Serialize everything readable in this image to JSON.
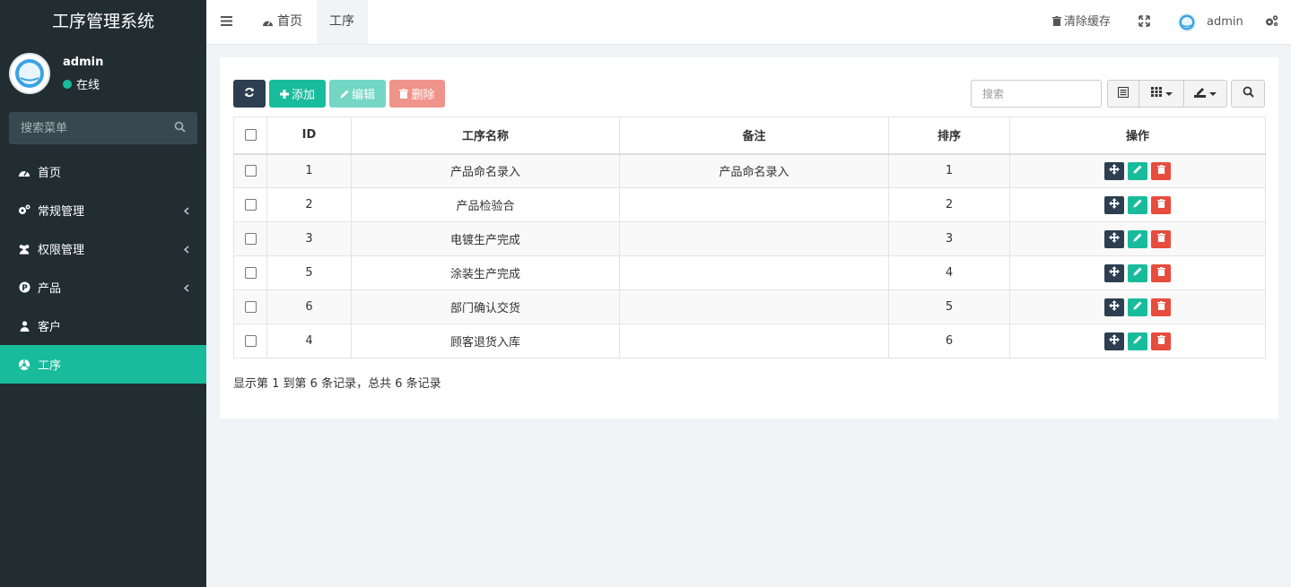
{
  "sidebar": {
    "brand": "工序管理系统",
    "user": {
      "name": "admin",
      "status": "在线"
    },
    "search_placeholder": "搜索菜单",
    "items": [
      {
        "label": "首页",
        "icon": "dashboard-icon",
        "has_children": false,
        "active": false
      },
      {
        "label": "常规管理",
        "icon": "cogs-icon",
        "has_children": true,
        "active": false
      },
      {
        "label": "权限管理",
        "icon": "users-icon",
        "has_children": true,
        "active": false
      },
      {
        "label": "产品",
        "icon": "product-p-icon",
        "has_children": true,
        "active": false
      },
      {
        "label": "客户",
        "icon": "user-icon",
        "has_children": false,
        "active": false
      },
      {
        "label": "工序",
        "icon": "process-icon",
        "has_children": false,
        "active": true
      }
    ]
  },
  "header": {
    "tabs": [
      {
        "label": "首页"
      },
      {
        "label": "工序"
      }
    ],
    "clear_cache": "清除缓存",
    "user_name": "admin"
  },
  "toolbar": {
    "add_label": "添加",
    "edit_label": "编辑",
    "delete_label": "删除",
    "search_placeholder": "搜索"
  },
  "table": {
    "columns": [
      "ID",
      "工序名称",
      "备注",
      "排序",
      "操作"
    ],
    "rows": [
      {
        "id": "1",
        "name": "产品命名录入",
        "remark": "产品命名录入",
        "sort": "1"
      },
      {
        "id": "2",
        "name": "产品检验合",
        "remark": "",
        "sort": "2"
      },
      {
        "id": "3",
        "name": "电镀生产完成",
        "remark": "",
        "sort": "3"
      },
      {
        "id": "5",
        "name": "涂装生产完成",
        "remark": "",
        "sort": "4"
      },
      {
        "id": "6",
        "name": "部门确认交货",
        "remark": "",
        "sort": "5"
      },
      {
        "id": "4",
        "name": "顾客退货入库",
        "remark": "",
        "sort": "6"
      }
    ]
  },
  "pagination_text": "显示第 1 到第 6 条记录，总共 6 条记录",
  "colors": {
    "sidebar": "#222d32",
    "accent": "#18bc9c",
    "dark": "#2c3e50",
    "danger": "#e74c3c"
  }
}
